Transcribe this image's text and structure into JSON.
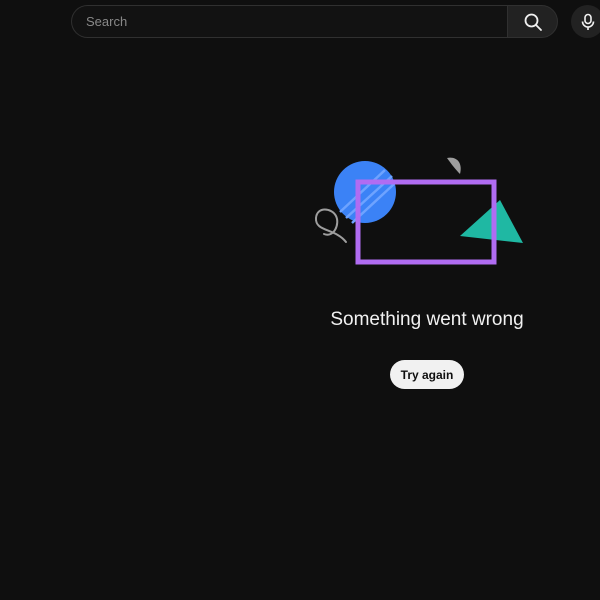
{
  "header": {
    "search": {
      "value": "",
      "placeholder": "Search"
    },
    "search_button_icon": "search-icon",
    "mic_button_icon": "microphone-icon"
  },
  "error": {
    "illustration": "error-illustration",
    "message": "Something went wrong",
    "retry_label": "Try again"
  },
  "colors": {
    "background": "#0f0f0f",
    "text": "#f1f1f1",
    "illustration_circle": "#3b82f6",
    "illustration_frame": "#b06cf2",
    "illustration_triangle": "#1fb8a3",
    "illustration_line": "#9e9e9e"
  }
}
